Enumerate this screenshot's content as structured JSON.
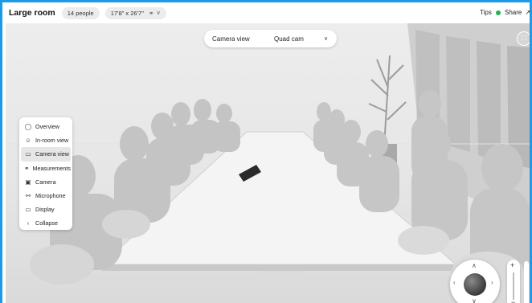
{
  "header": {
    "room_name": "Large room",
    "people": "14 people",
    "dimensions": "17'8\" x 26'7\"",
    "tips_label": "Tips",
    "tips_status_color": "#1fb256",
    "share_label": "Share"
  },
  "camera_dropdown": {
    "label": "Camera view",
    "value": "Quad cam"
  },
  "menu": {
    "items": [
      {
        "label": "Overview",
        "icon": "overview-icon",
        "active": false
      },
      {
        "label": "In-room view",
        "icon": "person-icon",
        "active": false
      },
      {
        "label": "Camera view",
        "icon": "camera-icon",
        "active": true
      },
      {
        "label": "Measurements",
        "icon": "ruler-icon",
        "active": false
      },
      {
        "label": "Camera",
        "icon": "camera-device-icon",
        "active": false
      },
      {
        "label": "Microphone",
        "icon": "microphone-icon",
        "active": false
      },
      {
        "label": "Display",
        "icon": "display-icon",
        "active": false
      },
      {
        "label": "Collapse",
        "icon": "chevron-left-icon",
        "active": false
      }
    ]
  },
  "zoom": {
    "plus": "+",
    "minus": "−"
  },
  "colors": {
    "frame_border": "#1a9be8",
    "accent_active": "#e6e6e6"
  }
}
